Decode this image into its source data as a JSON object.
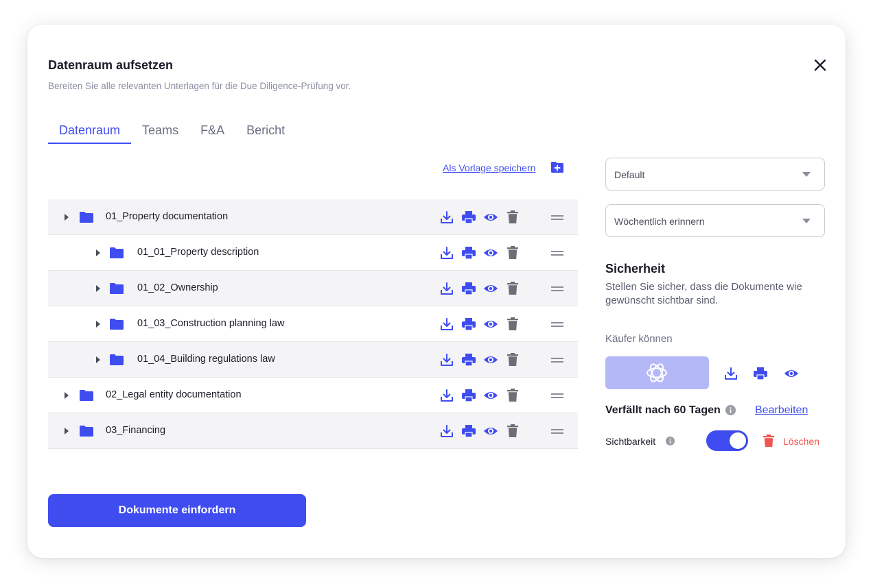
{
  "modal": {
    "title": "Datenraum aufsetzen",
    "subtitle": "Bereiten Sie alle relevanten Unterlagen für die Due Diligence-Prüfung vor."
  },
  "tabs": [
    {
      "label": "Datenraum",
      "active": true
    },
    {
      "label": "Teams",
      "active": false
    },
    {
      "label": "F&A",
      "active": false
    },
    {
      "label": "Bericht",
      "active": false
    }
  ],
  "toolbar": {
    "save_template_label": "Als Vorlage speichern"
  },
  "tree": [
    {
      "label": "01_Property documentation",
      "level": 0
    },
    {
      "label": "01_01_Property description",
      "level": 1
    },
    {
      "label": "01_02_Ownership",
      "level": 1
    },
    {
      "label": "01_03_Construction planning law",
      "level": 1
    },
    {
      "label": "01_04_Building regulations law",
      "level": 1
    },
    {
      "label": "02_Legal entity documentation",
      "level": 0
    },
    {
      "label": "03_Financing",
      "level": 0
    }
  ],
  "request_button_label": "Dokumente einfordern",
  "settings": {
    "template_select": "Default",
    "reminder_select": "Wöchentlich erinnern",
    "security_title": "Sicherheit",
    "security_desc": "Stellen Sie sicher, dass die Dokumente wie gewünscht sichtbar sind.",
    "buyers_label": "Käufer können",
    "expiry_label": "Verfällt nach 60 Tagen",
    "edit_label": "Bearbeiten",
    "visibility_label": "Sichtbarkeit",
    "visibility_on": true,
    "delete_label": "Löschen"
  },
  "colors": {
    "accent": "#3f4df0",
    "danger": "#f0554f",
    "icon_gray": "#6e6e78"
  }
}
